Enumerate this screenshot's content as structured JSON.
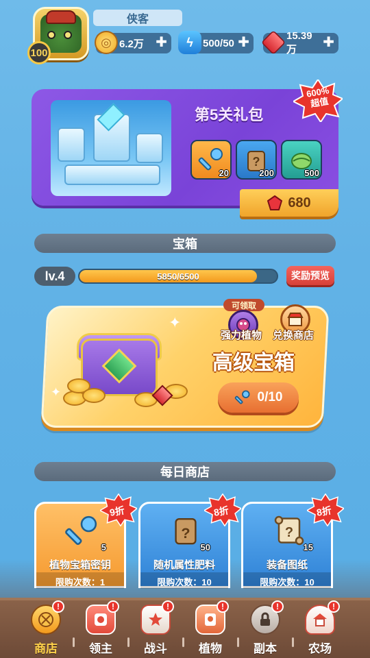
{
  "player": {
    "name": "侠客",
    "level": "100"
  },
  "resources": {
    "gold": "6.2万",
    "energy": "500/50",
    "gems": "15.39万"
  },
  "gift_pack": {
    "title": "第5关礼包",
    "burst_line1": "600%",
    "burst_line2": "超值",
    "items": [
      {
        "icon": "key-icon",
        "count": "20"
      },
      {
        "icon": "mystery-bag-icon",
        "count": "200"
      },
      {
        "icon": "seed-pod-icon",
        "count": "500"
      }
    ],
    "price": "680"
  },
  "chest_section": {
    "title": "宝箱",
    "level_label": "lv.4",
    "progress_text": "5850/6500",
    "progress_fraction": 0.9,
    "preview_label": "奖励预览",
    "claimable_tag": "可领取",
    "strong_plant_label": "强力植物",
    "exchange_shop_label": "兑换商店",
    "chest_name": "高级宝箱",
    "key_progress": "0/10"
  },
  "daily_shop": {
    "title": "每日商店",
    "cards": [
      {
        "name": "植物宝箱密钥",
        "limit": "限购次数：1",
        "count": "5",
        "discount": "9折",
        "icon": "key-icon",
        "bg": "#f6a63a"
      },
      {
        "name": "随机属性肥料",
        "limit": "限购次数：10",
        "count": "50",
        "discount": "8折",
        "icon": "fertilizer-bag-icon",
        "bg": "#3f94e0"
      },
      {
        "name": "装备图纸",
        "limit": "限购次数：10",
        "count": "15",
        "discount": "8折",
        "icon": "blueprint-scroll-icon",
        "bg": "#3f94e0"
      }
    ]
  },
  "nav": {
    "items": [
      {
        "label": "商店",
        "icon": "shop-icon",
        "active": true
      },
      {
        "label": "领主",
        "icon": "lord-icon"
      },
      {
        "label": "战斗",
        "icon": "battle-icon"
      },
      {
        "label": "植物",
        "icon": "plant-icon"
      },
      {
        "label": "副本",
        "icon": "dungeon-icon"
      },
      {
        "label": "农场",
        "icon": "farm-icon"
      }
    ]
  },
  "colors": {
    "background": "#62b2e6",
    "accent_orange": "#f39a1d",
    "gift_purple": "#8d58e6",
    "nav_brown": "#7a553f",
    "active_nav": "#ffd24a"
  }
}
